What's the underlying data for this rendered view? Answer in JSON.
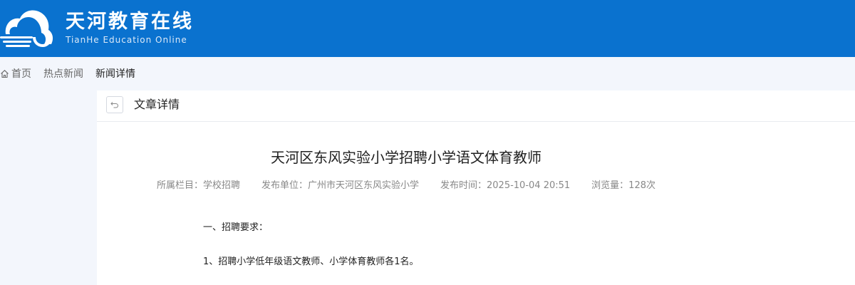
{
  "header": {
    "brand_title": "天河教育在线",
    "brand_subtitle": "TianHe Education Online",
    "bg_color": "#0a72cf",
    "logo_icon": "cloud-logo-icon"
  },
  "breadcrumb": {
    "home_icon": "home-icon",
    "home_label": "首页",
    "section_label": "热点新闻",
    "current_label": "新闻详情"
  },
  "panel": {
    "back_icon": "back-arrow-icon",
    "title": "文章详情"
  },
  "article": {
    "title": "天河区东风实验小学招聘小学语文体育教师",
    "meta": {
      "column": "所属栏目：学校招聘",
      "publisher": "发布单位：广州市天河区东风实验小学",
      "publish_time": "发布时间：2025-10-04 20:51",
      "views": "浏览量：128次"
    },
    "paragraphs": [
      "一、招聘要求：",
      "1、招聘小学低年级语文教师、小学体育教师各1名。"
    ]
  }
}
